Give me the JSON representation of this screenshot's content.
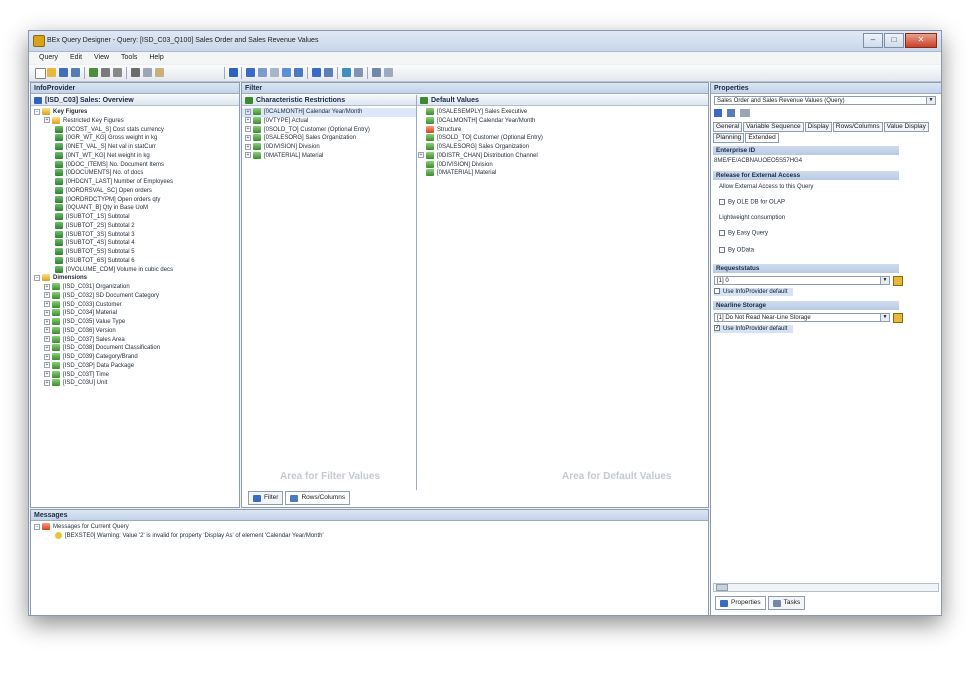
{
  "window": {
    "title": "BEx Query Designer - Query: [ISD_C03_Q100] Sales Order and Sales Revenue Values"
  },
  "menu": [
    "Query",
    "Edit",
    "View",
    "Tools",
    "Help"
  ],
  "infoprovider": {
    "header": "InfoProvider",
    "provider": "[ISD_C03] Sales: Overview",
    "key_figures_label": "Key Figures",
    "restricted_label": "Restricted Key Figures",
    "key_figures": [
      "[0COST_VAL_S] Cost stats currency",
      "[0GR_WT_KG] Gross weight in kg",
      "[0NET_VAL_S] Net val in statCurr",
      "[0NT_WT_KG] Net weight in kg",
      "[0DOC_ITEMS] No. Document Items",
      "[0DOCUMENTS] No. of docs",
      "[0HDCNT_LAST] Number of Employees",
      "[0ORDRSVAL_SC] Open orders",
      "[0ORDRDCTYPM] Open orders qty",
      "[0QUANT_B] Qty in Base UoM",
      "[ISUBTOT_1S] Subtotal",
      "[ISUBTOT_2S] Subtotal 2",
      "[ISUBTOT_3S] Subtotal 3",
      "[ISUBTOT_4S] Subtotal 4",
      "[ISUBTOT_5S] Subtotal 5",
      "[ISUBTOT_6S] Subtotal 6",
      "[0VOLUME_CDM] Volume in cubic decs"
    ],
    "dimensions_label": "Dimensions",
    "dimensions": [
      "[ISD_C031] Organization",
      "[ISD_C032] SD Document Category",
      "[ISD_C033] Customer",
      "[ISD_C034] Material",
      "[ISD_C035] Value Type",
      "[ISD_C036] Version",
      "[ISD_C037] Sales Area",
      "[ISD_C038] Document Classification",
      "[ISD_C039] Category/Brand",
      "[ISD_C03P] Data Package",
      "[ISD_C03T] Time",
      "[ISD_C03U] Unit"
    ]
  },
  "filter": {
    "header": "Filter",
    "char_restrictions_label": "Characteristic Restrictions",
    "char_restrictions": [
      "[0CALMONTH] Calendar Year/Month",
      "[0VTYPE] Actual",
      "[0SOLD_TO] Customer (Optional Entry)",
      "[0SALESORG] Sales Organization",
      "[0DIVISION] Division",
      "[0MATERIAL] Material"
    ],
    "default_values_label": "Default Values",
    "default_values": [
      "[0SALESEMPLY] Sales Executive",
      "[0CALMONTH] Calendar Year/Month",
      "Structure",
      "[0SOLD_TO] Customer (Optional Entry)",
      "[0SALESORG] Sales Organization",
      "[0DISTR_CHAN] Distribution Channel",
      "[0DIVISION] Division",
      "[0MATERIAL] Material"
    ],
    "watermark_filter": "Area for Filter Values",
    "watermark_default": "Area for Default Values",
    "tabs": [
      "Filter",
      "Rows/Columns"
    ]
  },
  "properties": {
    "header": "Properties",
    "selector": "Sales Order and Sales Revenue Values (Query)",
    "tabs": [
      "General",
      "Variable Sequence",
      "Display",
      "Rows/Columns",
      "Value Display",
      "Planning",
      "Extended"
    ],
    "technical_id_label": "Enterprise ID",
    "technical_id_value": "8ME/FE/ACBNAUOEO5S57HG4",
    "release_label": "Release for External Access",
    "allow_label": "Allow External Access to this Query",
    "by_ole": "By OLE DB for OLAP",
    "lightweight": "Lightweight consumption",
    "by_easy": "By Easy Query",
    "by_odata": "By OData",
    "requeststatus_label": "Requeststatus",
    "requeststatus_value": "[1] 0",
    "use_infoprovider_1": "Use InfoProvider default",
    "nearline_label": "Nearline Storage",
    "nearline_value": "[1] Do Not Read Near-Line Storage",
    "use_infoprovider_2": "Use InfoProvider default",
    "bottom_tabs": [
      "Properties",
      "Tasks"
    ]
  },
  "messages": {
    "header": "Messages",
    "group": "Messages for Current Query",
    "items": [
      "[BEXSTE0] Warning: Value '2' is invalid for property 'Display As' of element 'Calendar Year/Month'"
    ]
  },
  "colors": {
    "pane_header": "#c2d2e8",
    "accent": "#3a6bc4",
    "key_figure_icon": "#2e7d32",
    "folder_icon": "#d9a21b"
  }
}
